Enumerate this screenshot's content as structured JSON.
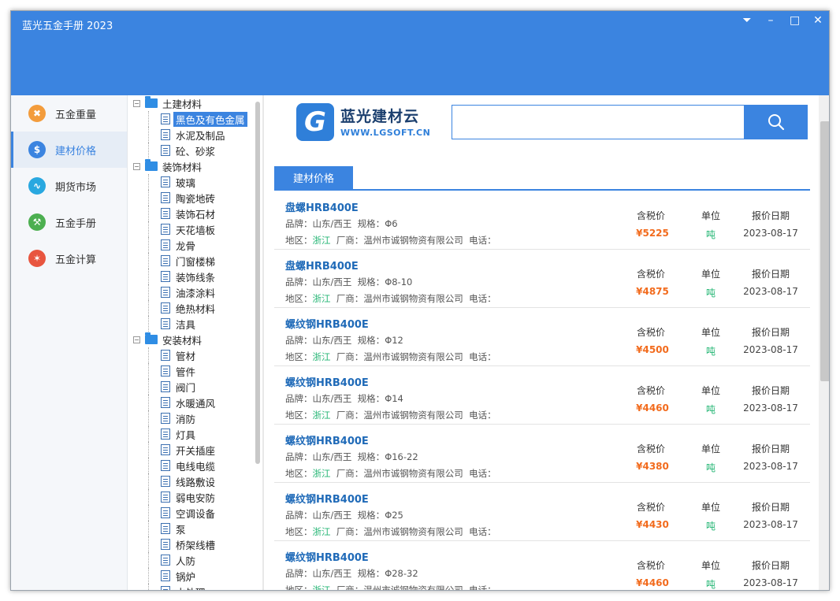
{
  "app": {
    "title": "蓝光五金手册 2023",
    "controls": [
      "⏷",
      "–",
      "□",
      "✕"
    ]
  },
  "sidebar": {
    "items": [
      {
        "label": "五金重量",
        "icon": "weight-icon",
        "color": "#f39c3c"
      },
      {
        "label": "建材价格",
        "icon": "dollar-icon",
        "color": "#3b84e0"
      },
      {
        "label": "期货市场",
        "icon": "trend-icon",
        "color": "#29a8e0"
      },
      {
        "label": "五金手册",
        "icon": "wrench-icon",
        "color": "#4caf50"
      },
      {
        "label": "五金计算",
        "icon": "calculator-icon",
        "color": "#e8553f"
      }
    ],
    "active_index": 1
  },
  "tree": {
    "categories": [
      {
        "label": "土建材料",
        "children": [
          "黑色及有色金属",
          "水泥及制品",
          "砼、砂浆"
        ]
      },
      {
        "label": "装饰材料",
        "children": [
          "玻璃",
          "陶瓷地砖",
          "装饰石材",
          "天花墙板",
          "龙骨",
          "门窗楼梯",
          "装饰线条",
          "油漆涂料",
          "绝热材料",
          "洁具"
        ]
      },
      {
        "label": "安装材料",
        "children": [
          "管材",
          "管件",
          "阀门",
          "水暖通风",
          "消防",
          "灯具",
          "开关插座",
          "电线电缆",
          "线路敷设",
          "弱电安防",
          "空调设备",
          "泵",
          "桥架线槽",
          "人防",
          "锅炉",
          "水处理"
        ]
      }
    ],
    "selected": "黑色及有色金属",
    "expander": "−"
  },
  "header": {
    "logo_letter": "G",
    "logo_title": "蓝光建材云",
    "logo_url": "WWW.LGSOFT.CN",
    "search_value": ""
  },
  "tab": {
    "label": "建材价格"
  },
  "columns": {
    "price": "含税价",
    "unit": "单位",
    "date": "报价日期"
  },
  "labels": {
    "brand": "品牌：",
    "spec": "规格：",
    "region": "地区：",
    "vendor": "厂商：",
    "phone": "电话："
  },
  "products": [
    {
      "name": "盘螺HRB400E",
      "brand": "山东/西王",
      "spec": "Φ6",
      "region": "浙江",
      "vendor": "温州市诚钢物资有限公司",
      "price": "¥5225",
      "unit": "吨",
      "date": "2023-08-17"
    },
    {
      "name": "盘螺HRB400E",
      "brand": "山东/西王",
      "spec": "Φ8-10",
      "region": "浙江",
      "vendor": "温州市诚钢物资有限公司",
      "price": "¥4875",
      "unit": "吨",
      "date": "2023-08-17"
    },
    {
      "name": "螺纹钢HRB400E",
      "brand": "山东/西王",
      "spec": "Φ12",
      "region": "浙江",
      "vendor": "温州市诚钢物资有限公司",
      "price": "¥4500",
      "unit": "吨",
      "date": "2023-08-17"
    },
    {
      "name": "螺纹钢HRB400E",
      "brand": "山东/西王",
      "spec": "Φ14",
      "region": "浙江",
      "vendor": "温州市诚钢物资有限公司",
      "price": "¥4460",
      "unit": "吨",
      "date": "2023-08-17"
    },
    {
      "name": "螺纹钢HRB400E",
      "brand": "山东/西王",
      "spec": "Φ16-22",
      "region": "浙江",
      "vendor": "温州市诚钢物资有限公司",
      "price": "¥4380",
      "unit": "吨",
      "date": "2023-08-17"
    },
    {
      "name": "螺纹钢HRB400E",
      "brand": "山东/西王",
      "spec": "Φ25",
      "region": "浙江",
      "vendor": "温州市诚钢物资有限公司",
      "price": "¥4430",
      "unit": "吨",
      "date": "2023-08-17"
    },
    {
      "name": "螺纹钢HRB400E",
      "brand": "山东/西王",
      "spec": "Φ28-32",
      "region": "浙江",
      "vendor": "温州市诚钢物资有限公司",
      "price": "¥4460",
      "unit": "吨",
      "date": "2023-08-17"
    }
  ]
}
